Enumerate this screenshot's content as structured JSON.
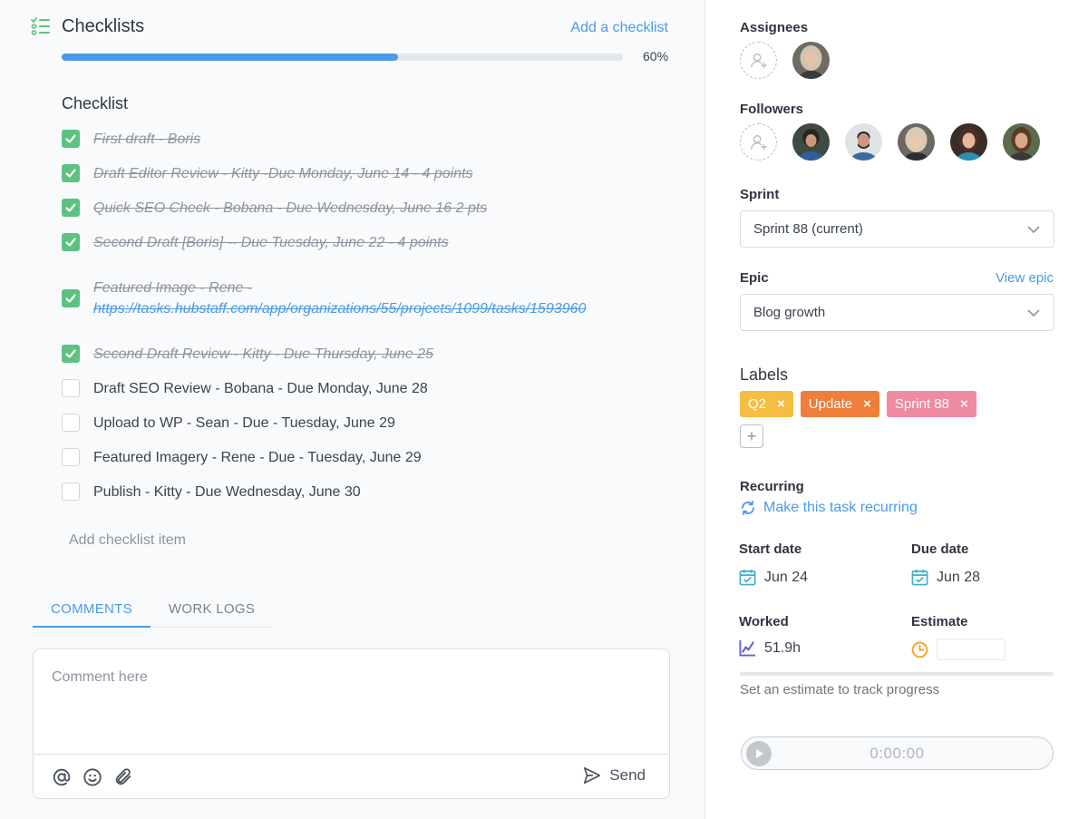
{
  "checklists": {
    "title": "Checklists",
    "add_checklist": "Add a checklist",
    "progress_percent": 60,
    "progress_label": "60%",
    "checklist_title": "Checklist",
    "items": [
      {
        "text": "First draft - Boris",
        "done": true
      },
      {
        "text": "Draft Editor Review - Kitty -Due Monday, June 14 - 4 points",
        "done": true
      },
      {
        "text": "Quick SEO Check - Bobana - Due Wednesday, June 16 2 pts",
        "done": true
      },
      {
        "text": "Second Draft [Boris] -- Due Tuesday, June 22 - 4 points",
        "done": true
      },
      {
        "text": "Featured Image - Rene -",
        "link": "https://tasks.hubstaff.com/app/organizations/55/projects/1099/tasks/1593960",
        "done": true
      },
      {
        "text": "Second Draft Review - Kitty - Due Thursday, June 25",
        "done": true
      },
      {
        "text": "Draft SEO Review - Bobana - Due Monday, June 28",
        "done": false
      },
      {
        "text": "Upload to WP - Sean - Due - Tuesday, June 29",
        "done": false
      },
      {
        "text": "Featured Imagery - Rene - Due - Tuesday, June 29",
        "done": false
      },
      {
        "text": "Publish - Kitty - Due Wednesday, June 30",
        "done": false
      }
    ],
    "add_item": "Add checklist item"
  },
  "tabs": [
    {
      "label": "COMMENTS",
      "active": true
    },
    {
      "label": "WORK LOGS",
      "active": false
    }
  ],
  "comment": {
    "placeholder": "Comment here",
    "send_label": "Send"
  },
  "sidebar": {
    "assignees_label": "Assignees",
    "followers_label": "Followers",
    "sprint_label": "Sprint",
    "sprint_value": "Sprint 88 (current)",
    "epic_label": "Epic",
    "view_epic": "View epic",
    "epic_value": "Blog growth",
    "labels_label": "Labels",
    "labels": [
      {
        "name": "Q2",
        "color": "#f5bd41"
      },
      {
        "name": "Update",
        "color": "#f07d3a"
      },
      {
        "name": "Sprint 88",
        "color": "#f08aa0"
      }
    ],
    "recurring_label": "Recurring",
    "recurring_link": "Make this task recurring",
    "start_date_label": "Start date",
    "start_date": "Jun 24",
    "due_date_label": "Due date",
    "due_date": "Jun 28",
    "worked_label": "Worked",
    "worked_value": "51.9h",
    "estimate_label": "Estimate",
    "estimate_hint": "Set an estimate to track progress",
    "timer_value": "0:00:00"
  },
  "colors": {
    "accent": "#4b9ae8",
    "check_green": "#5dc27f",
    "calendar_teal": "#3bb1c9",
    "worked_purple": "#5c62d6",
    "estimate_orange": "#f5a623"
  }
}
